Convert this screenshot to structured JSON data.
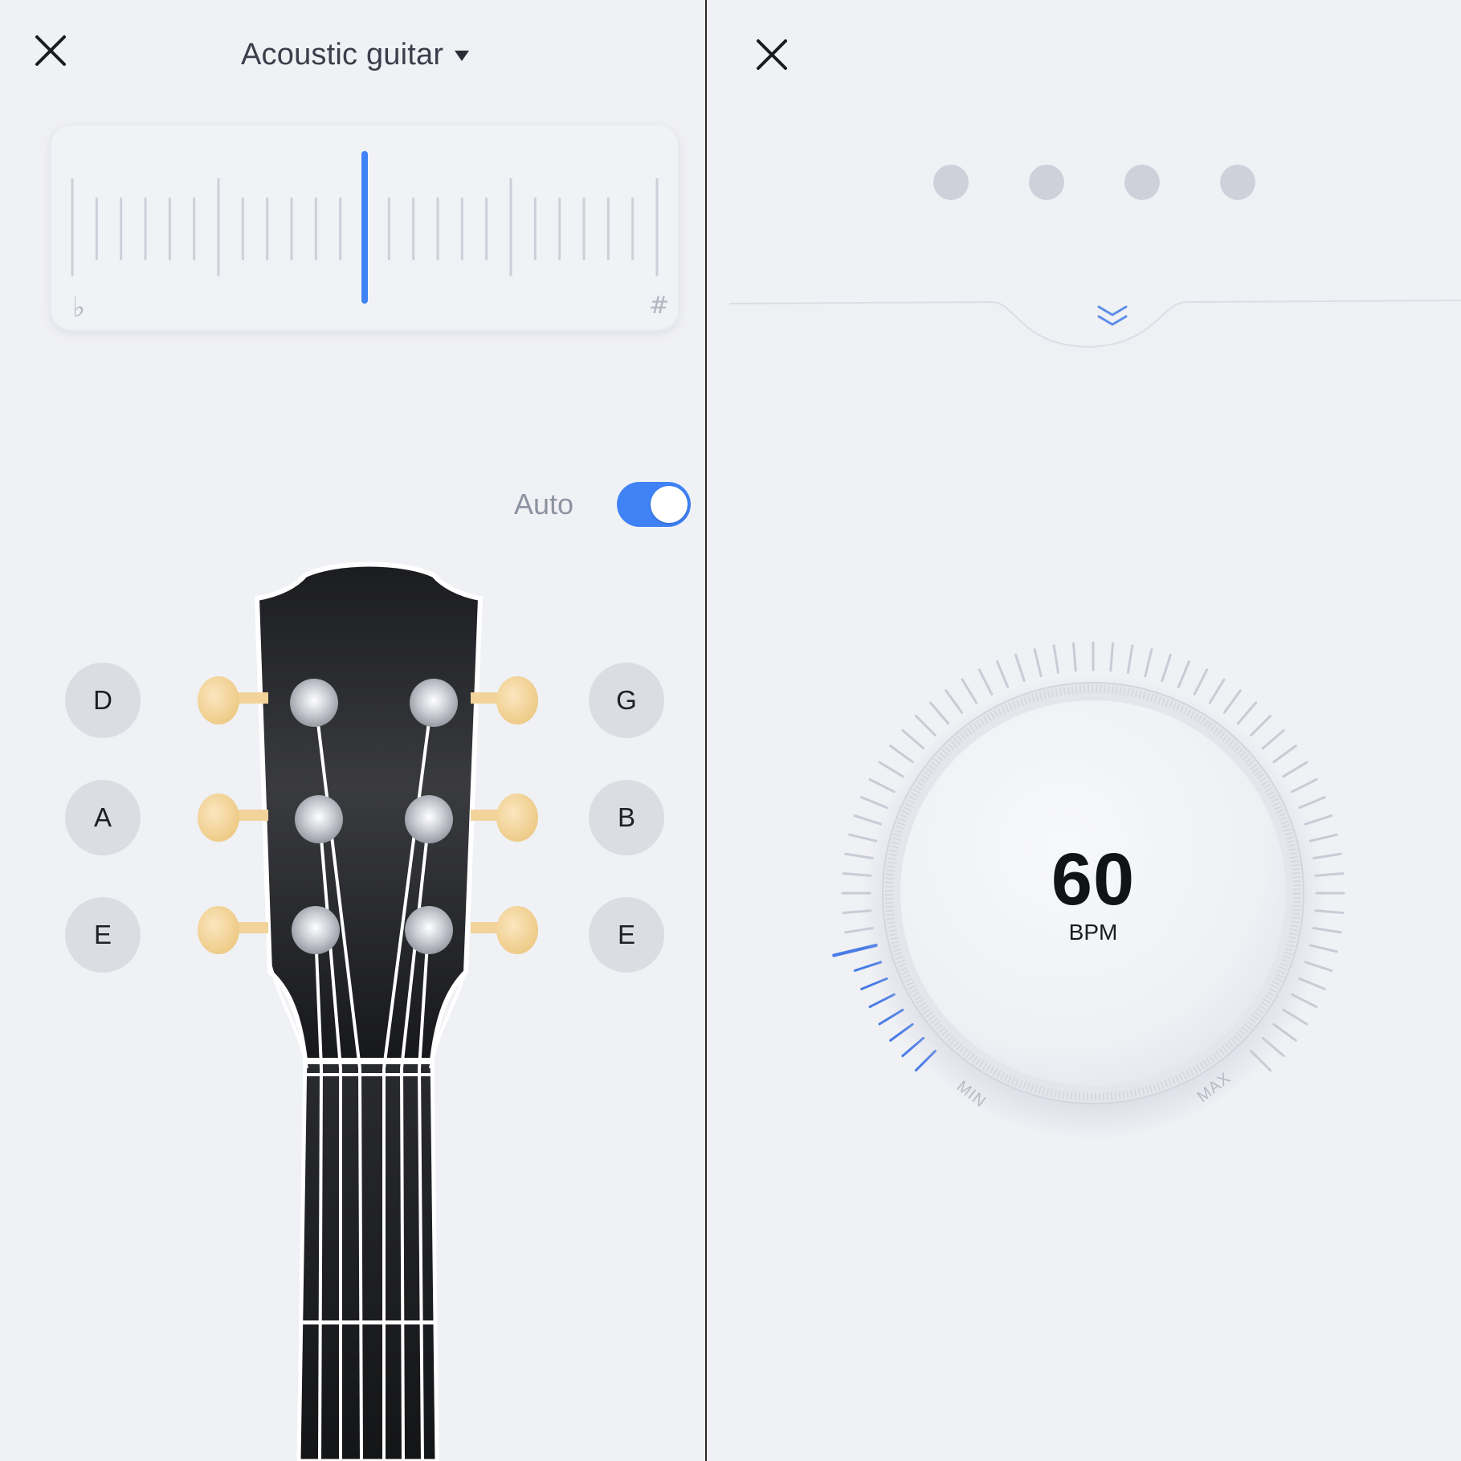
{
  "tuner": {
    "instrument": "Acoustic guitar",
    "flat_symbol": "♭",
    "sharp_symbol": "#",
    "auto_label": "Auto",
    "auto_enabled": true,
    "needle_position": 0.5,
    "strings_left": [
      "D",
      "A",
      "E"
    ],
    "strings_right": [
      "G",
      "B",
      "E"
    ]
  },
  "metronome": {
    "bpm": "60",
    "bpm_unit": "BPM",
    "min_label": "MIN",
    "max_label": "MAX",
    "beats": 4,
    "level": 0.12
  },
  "colors": {
    "accent": "#3f82f5",
    "background": "#f0f1f5",
    "headstock": "#232428",
    "tuner_peg": "#f2d39a"
  },
  "icons": {
    "close": "close-icon",
    "dropdown": "caret-down-icon",
    "drawer": "double-chevron-down-icon"
  }
}
